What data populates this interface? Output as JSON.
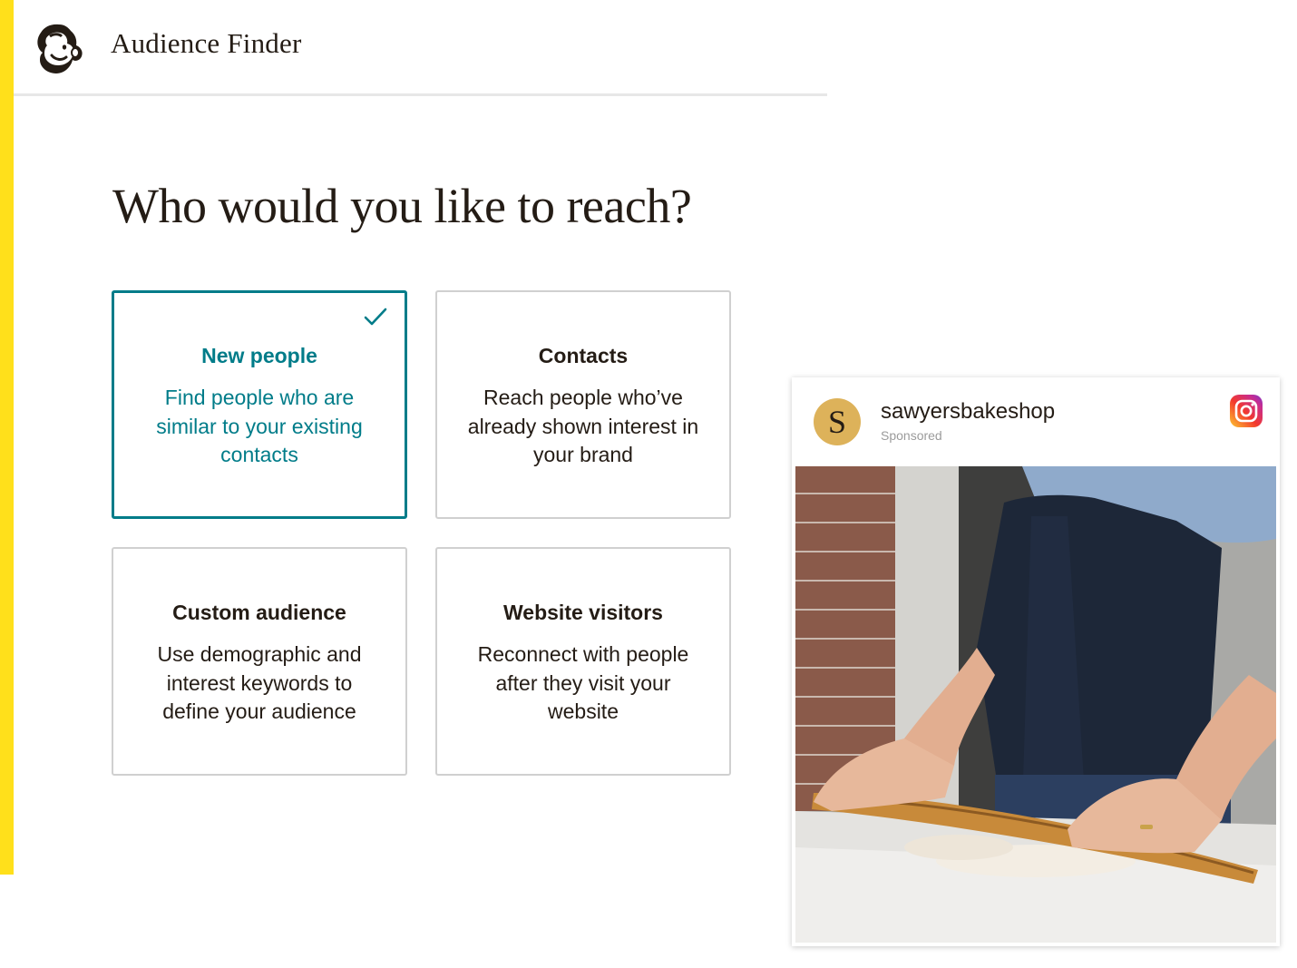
{
  "app": {
    "title": "Audience Finder",
    "logo_icon": "mailchimp-freddie-icon",
    "accent_color": "#ffe01b"
  },
  "main": {
    "heading": "Who would you like to reach?",
    "selected_color": "#007c89",
    "options": [
      {
        "title": "New people",
        "description": "Find people who are similar to your existing contacts",
        "selected": true
      },
      {
        "title": "Contacts",
        "description": "Reach people who’ve already shown interest in your brand",
        "selected": false
      },
      {
        "title": "Custom audience",
        "description": "Use demographic and interest keywords to define your audience",
        "selected": false
      },
      {
        "title": "Website visitors",
        "description": "Reconnect with people after they visit your website",
        "selected": false
      }
    ]
  },
  "ad_preview": {
    "avatar_letter": "S",
    "username": "sawyersbakeshop",
    "sponsored_label": "Sponsored",
    "platform_icon": "instagram-icon",
    "image": "baker-rolling-dough-photo"
  }
}
